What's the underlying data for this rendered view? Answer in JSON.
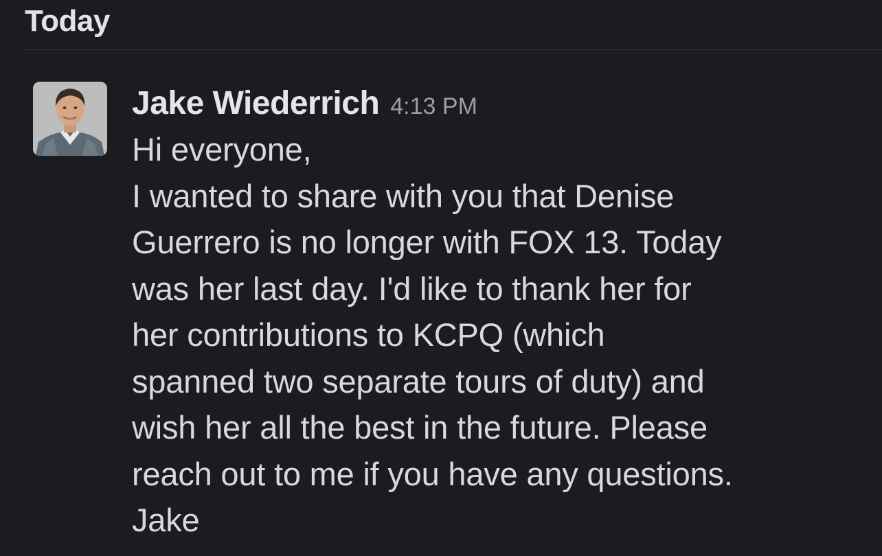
{
  "day_divider": {
    "label": "Today"
  },
  "message": {
    "author": "Jake Wiederrich",
    "timestamp": "4:13 PM",
    "lines": [
      "Hi everyone,",
      "I wanted to share with you that Denise",
      "Guerrero is no longer with FOX 13. Today",
      "was her last day. I'd like to thank her for",
      "her contributions to KCPQ (which",
      "spanned two separate tours of duty) and",
      "wish her all the best in the future. Please",
      "reach out to me if you have any questions.",
      "Jake"
    ]
  },
  "colors": {
    "background": "#1b1c20",
    "primary_text": "#d9d9db",
    "secondary_text": "#9d9ea3",
    "divider": "#34353a"
  }
}
